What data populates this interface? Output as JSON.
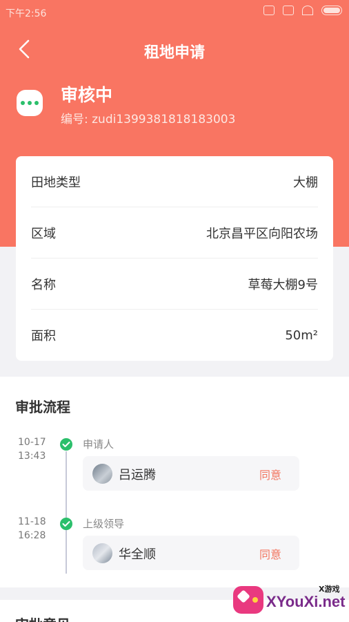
{
  "status_bar": {
    "time": "下午2:56"
  },
  "header": {
    "title": "租地申请",
    "status": "审核中",
    "number": "编号: zudi1399381818183003"
  },
  "info": {
    "rows": [
      {
        "label": "田地类型",
        "value": "大棚"
      },
      {
        "label": "区域",
        "value": "北京昌平区向阳农场"
      },
      {
        "label": "名称",
        "value": "草莓大棚9号"
      },
      {
        "label": "面积",
        "value": "50m²"
      }
    ]
  },
  "flow": {
    "title": "审批流程",
    "steps": [
      {
        "date": "10-17",
        "time": "13:43",
        "role": "申请人",
        "name": "吕运腾",
        "state": "同意"
      },
      {
        "date": "11-18",
        "time": "16:28",
        "role": "上级领导",
        "name": "华全顺",
        "state": "同意"
      }
    ]
  },
  "opinion": {
    "title": "审批意见"
  },
  "watermark": {
    "text": "XYouXi.net",
    "sub": "X游戏"
  },
  "colors": {
    "accent": "#f97562",
    "success": "#2bbf6b",
    "approve": "#f2755f"
  }
}
